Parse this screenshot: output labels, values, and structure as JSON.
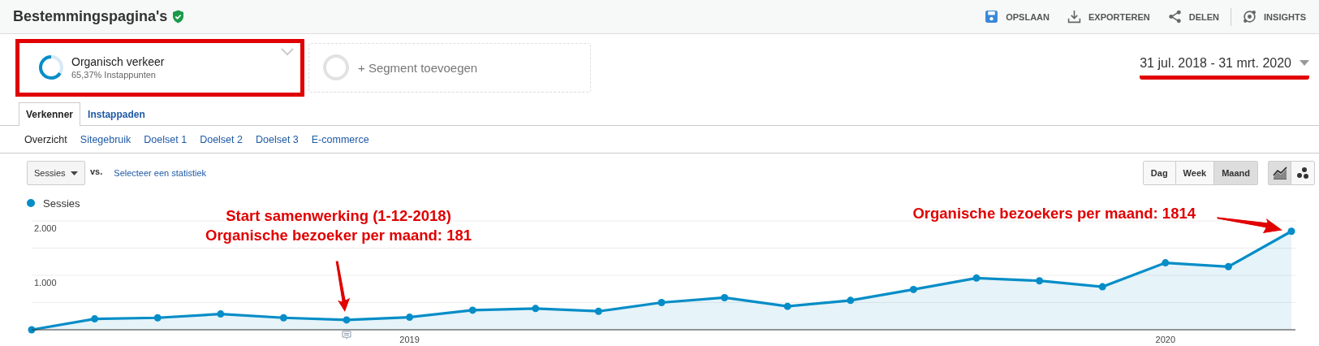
{
  "header": {
    "title": "Bestemmingspagina's",
    "verified": true,
    "actions": [
      {
        "kind": "save",
        "label": "OPSLAAN"
      },
      {
        "kind": "download",
        "label": "EXPORTEREN"
      },
      {
        "kind": "share",
        "label": "DELEN"
      },
      {
        "kind": "insights",
        "label": "INSIGHTS"
      }
    ]
  },
  "segments": [
    {
      "kind": "segment",
      "name": "Organisch verkeer",
      "detail": "65,37% Instappunten",
      "level": 0.6537,
      "highlighted": true
    },
    {
      "kind": "add",
      "name": "+ Segment toevoegen"
    }
  ],
  "date_range": {
    "label": "31 jul. 2018 - 31 mrt. 2020",
    "underlined": true
  },
  "tabs": [
    {
      "label": "Verkenner",
      "selected": true
    },
    {
      "label": "Instappaden",
      "selected": false
    }
  ],
  "subtabs": [
    {
      "label": "Overzicht",
      "selected": true
    },
    {
      "label": "Sitegebruik",
      "selected": false
    },
    {
      "label": "Doelset 1",
      "selected": false
    },
    {
      "label": "Doelset 2",
      "selected": false
    },
    {
      "label": "Doelset 3",
      "selected": false
    },
    {
      "label": "E-commerce",
      "selected": false
    }
  ],
  "metric_select": {
    "value": "Sessies"
  },
  "vs_label": "vs.",
  "compare_link": "Selecteer een statistiek",
  "intervals": [
    {
      "label": "Dag",
      "selected": false
    },
    {
      "label": "Week",
      "selected": false
    },
    {
      "label": "Maand",
      "selected": true
    }
  ],
  "chart_types": [
    {
      "kind": "line",
      "selected": true
    },
    {
      "kind": "motion",
      "selected": false
    }
  ],
  "chart": {
    "chart_data": {
      "type": "area",
      "categories": [
        null,
        null,
        null,
        null,
        null,
        null,
        "2019",
        null,
        null,
        null,
        null,
        null,
        null,
        null,
        null,
        null,
        null,
        null,
        "2020",
        null,
        null
      ],
      "series": [
        {
          "name": "Sessies",
          "color": "#058dc7",
          "values": [
            0,
            200,
            220,
            290,
            220,
            180,
            230,
            360,
            390,
            340,
            500,
            590,
            430,
            540,
            740,
            950,
            900,
            790,
            1230,
            1160,
            1810
          ]
        }
      ],
      "ylim": [
        0,
        2000
      ],
      "yticks": [
        {
          "value": 1000,
          "label": "1.000"
        },
        {
          "value": 2000,
          "label": "2.000"
        }
      ],
      "annotations": [
        "Start samenwerking (1-12-2018)",
        "Organische bezoeker per maand: 181",
        "Organische bezoekers per maand: 1814"
      ]
    }
  }
}
